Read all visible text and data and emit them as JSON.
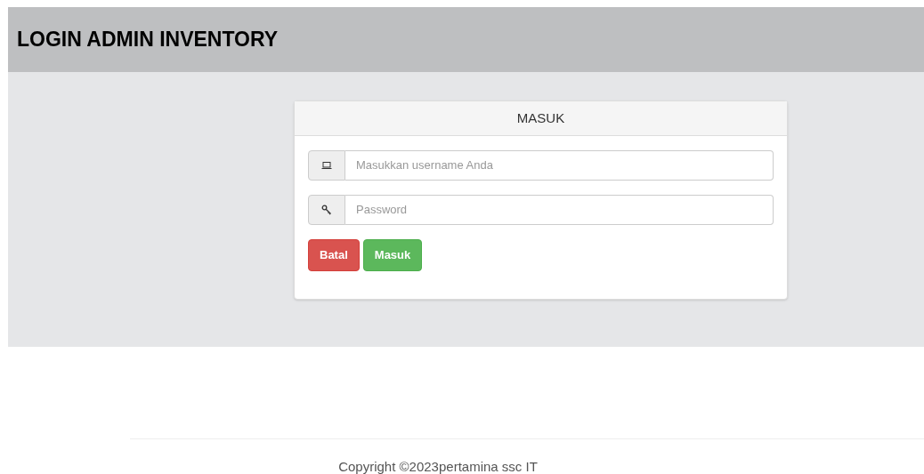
{
  "header": {
    "title": "LOGIN ADMIN INVENTORY"
  },
  "panel": {
    "title": "MASUK",
    "fields": [
      {
        "kind": "username",
        "placeholder": "Masukkan username Anda"
      },
      {
        "kind": "password",
        "placeholder": "Password"
      }
    ],
    "buttons": [
      {
        "kind": "cancel",
        "label": "Batal"
      },
      {
        "kind": "submit",
        "label": "Masuk"
      }
    ]
  },
  "footer": {
    "copyright": "Copyright ©2023pertamina ssc IT"
  }
}
